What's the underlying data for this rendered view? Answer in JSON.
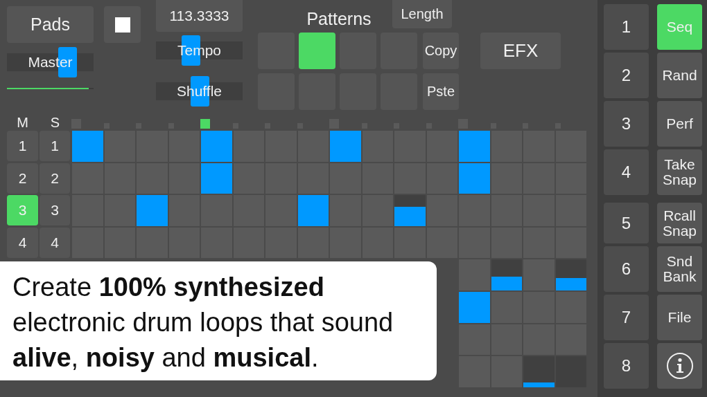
{
  "top_controls": {
    "pads_button": "Pads",
    "stop_button": {
      "kind": "stop"
    },
    "master": {
      "label": "Master",
      "level": 0.75
    },
    "master_meter": {
      "level": 0.94
    },
    "tempo_value": "113.3333",
    "tempo": {
      "label": "Tempo",
      "level": 0.38
    },
    "shuffle": {
      "label": "Shuffle",
      "level": 0.51
    }
  },
  "patterns": {
    "title": "Patterns",
    "length_button": "Length",
    "pads": [
      {
        "selected": false
      },
      {
        "selected": true
      },
      {
        "selected": false
      },
      {
        "selected": false
      },
      {
        "selected": false
      },
      {
        "selected": false
      },
      {
        "selected": false
      },
      {
        "selected": false
      }
    ],
    "copy_button": "Copy",
    "paste_button": "Pste"
  },
  "efx_button": "EFX",
  "sequencer": {
    "mute_header": "M",
    "solo_header": "S",
    "step_markers": [
      {
        "accent": true,
        "current": false
      },
      {
        "accent": false,
        "current": false
      },
      {
        "accent": false,
        "current": false
      },
      {
        "accent": false,
        "current": false
      },
      {
        "accent": true,
        "current": true
      },
      {
        "accent": false,
        "current": false
      },
      {
        "accent": false,
        "current": false
      },
      {
        "accent": false,
        "current": false
      },
      {
        "accent": true,
        "current": false
      },
      {
        "accent": false,
        "current": false
      },
      {
        "accent": false,
        "current": false
      },
      {
        "accent": false,
        "current": false
      },
      {
        "accent": true,
        "current": false
      },
      {
        "accent": false,
        "current": false
      },
      {
        "accent": false,
        "current": false
      },
      {
        "accent": false,
        "current": false
      }
    ],
    "rows": [
      {
        "mute": {
          "label": "1",
          "selected": false
        },
        "solo": {
          "label": "1"
        },
        "steps": [
          {
            "on": true,
            "level": 1
          },
          {
            "on": false
          },
          {
            "on": false
          },
          {
            "on": false
          },
          {
            "on": true,
            "level": 1
          },
          {
            "on": false
          },
          {
            "on": false
          },
          {
            "on": false
          },
          {
            "on": true,
            "level": 1
          },
          {
            "on": false
          },
          {
            "on": false
          },
          {
            "on": false
          },
          {
            "on": true,
            "level": 1
          },
          {
            "on": false
          },
          {
            "on": false
          },
          {
            "on": false
          }
        ]
      },
      {
        "mute": {
          "label": "2",
          "selected": false
        },
        "solo": {
          "label": "2"
        },
        "steps": [
          {
            "on": false
          },
          {
            "on": false
          },
          {
            "on": false
          },
          {
            "on": false
          },
          {
            "on": true,
            "level": 1
          },
          {
            "on": false
          },
          {
            "on": false
          },
          {
            "on": false
          },
          {
            "on": false
          },
          {
            "on": false
          },
          {
            "on": false
          },
          {
            "on": false
          },
          {
            "on": true,
            "level": 1
          },
          {
            "on": false
          },
          {
            "on": false
          },
          {
            "on": false
          }
        ]
      },
      {
        "mute": {
          "label": "3",
          "selected": true
        },
        "solo": {
          "label": "3"
        },
        "steps": [
          {
            "on": false
          },
          {
            "on": false
          },
          {
            "on": true,
            "level": 1
          },
          {
            "on": false
          },
          {
            "on": false
          },
          {
            "on": false
          },
          {
            "on": false
          },
          {
            "on": true,
            "level": 1
          },
          {
            "on": false
          },
          {
            "on": false
          },
          {
            "on": true,
            "level": 0.63
          },
          {
            "on": false
          },
          {
            "on": false
          },
          {
            "on": false
          },
          {
            "on": false
          },
          {
            "on": false
          }
        ]
      },
      {
        "mute": {
          "label": "4",
          "selected": false
        },
        "solo": {
          "label": "4"
        },
        "steps": [
          {
            "on": false
          },
          {
            "on": false
          },
          {
            "on": false
          },
          {
            "on": false
          },
          {
            "on": false
          },
          {
            "on": false
          },
          {
            "on": false
          },
          {
            "on": false
          },
          {
            "on": false
          },
          {
            "on": false
          },
          {
            "on": false
          },
          {
            "on": false
          },
          {
            "on": false
          },
          {
            "on": false
          },
          {
            "on": false
          },
          {
            "on": false
          }
        ]
      },
      {
        "steps": [
          {
            "on": false
          },
          {
            "on": true,
            "level": 0.45
          },
          {
            "on": false
          },
          {
            "on": true,
            "level": 0.4
          }
        ]
      },
      {
        "steps": [
          {
            "on": true,
            "level": 1
          },
          {
            "on": false
          },
          {
            "on": false
          },
          {
            "on": false
          }
        ]
      },
      {
        "steps": [
          {
            "on": false
          },
          {
            "on": false
          },
          {
            "on": false
          },
          {
            "on": false
          }
        ]
      },
      {
        "steps": [
          {
            "on": false
          },
          {
            "on": false
          },
          {
            "on": true,
            "level": 0.15
          },
          {
            "on": true
          }
        ]
      }
    ]
  },
  "track_buttons": [
    "1",
    "2",
    "3",
    "4",
    "5",
    "6",
    "7",
    "8"
  ],
  "mode_buttons": [
    {
      "kind": "text",
      "label": "Seq",
      "selected": true
    },
    {
      "kind": "text",
      "label": "Rand",
      "selected": false
    },
    {
      "kind": "text",
      "label": "Perf",
      "selected": false
    },
    {
      "kind": "text",
      "label": "Take Snap",
      "selected": false
    },
    {
      "kind": "text",
      "label": "Rcall Snap",
      "selected": false
    },
    {
      "kind": "text",
      "label": "Snd Bank",
      "selected": false
    },
    {
      "kind": "text",
      "label": "File",
      "selected": false
    },
    {
      "kind": "info",
      "selected": false
    }
  ],
  "promo_caption": "Create **100% synthesized** electronic drum loops that sound **alive**, **noisy** and **musical**."
}
